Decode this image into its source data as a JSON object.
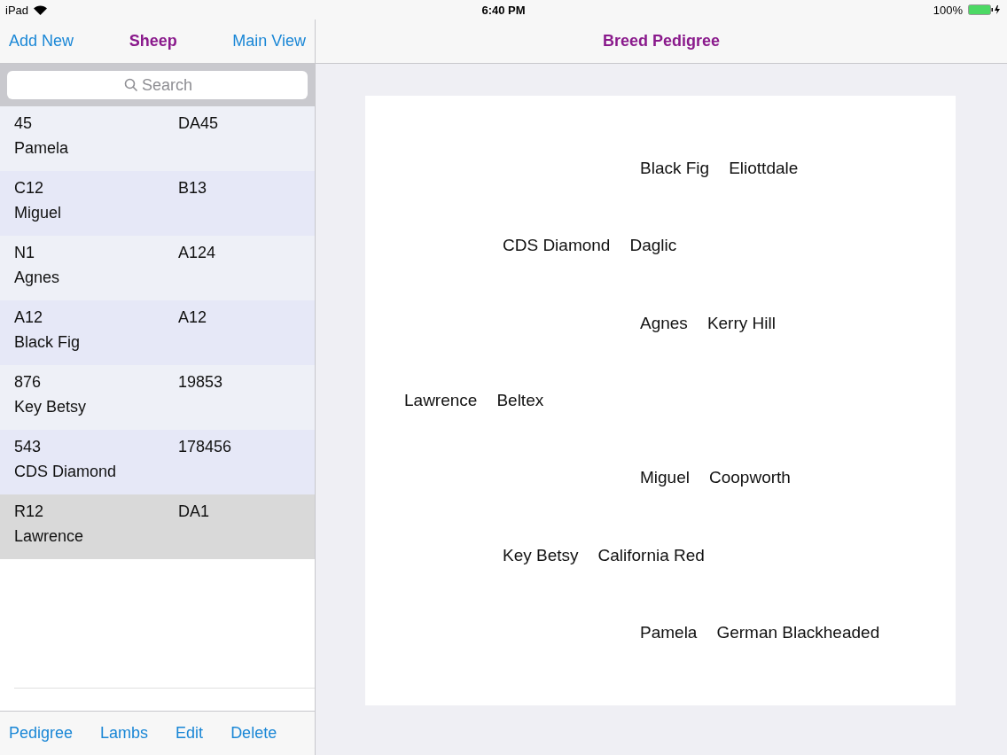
{
  "status_bar": {
    "device": "iPad",
    "time": "6:40 PM",
    "battery": "100%"
  },
  "sidebar": {
    "nav": {
      "left": "Add New",
      "title": "Sheep",
      "right": "Main View"
    },
    "search": {
      "placeholder": "Search"
    },
    "rows": [
      {
        "tag": "45",
        "id": "DA45",
        "name": "Pamela",
        "selected": false
      },
      {
        "tag": "C12",
        "id": "B13",
        "name": "Miguel",
        "selected": false
      },
      {
        "tag": "N1",
        "id": "A124",
        "name": "Agnes",
        "selected": false
      },
      {
        "tag": "A12",
        "id": "A12",
        "name": "Black Fig",
        "selected": false
      },
      {
        "tag": "876",
        "id": "19853",
        "name": "Key Betsy",
        "selected": false
      },
      {
        "tag": "543",
        "id": "178456",
        "name": "CDS Diamond",
        "selected": false
      },
      {
        "tag": "R12",
        "id": "DA1",
        "name": "Lawrence",
        "selected": true
      }
    ],
    "toolbar": [
      "Pedigree",
      "Lambs",
      "Edit",
      "Delete"
    ]
  },
  "detail": {
    "title": "Breed Pedigree",
    "pedigree": {
      "name": "Lawrence",
      "breed": "Beltex",
      "children": [
        {
          "name": "CDS Diamond",
          "breed": "Daglic",
          "children": [
            {
              "name": "Black Fig",
              "breed": "Eliottdale"
            },
            {
              "name": "Agnes",
              "breed": "Kerry Hill"
            }
          ]
        },
        {
          "name": "Key Betsy",
          "breed": "California Red",
          "children": [
            {
              "name": "Miguel",
              "breed": "Coopworth"
            },
            {
              "name": "Pamela",
              "breed": "German Blackheaded"
            }
          ]
        }
      ]
    }
  }
}
